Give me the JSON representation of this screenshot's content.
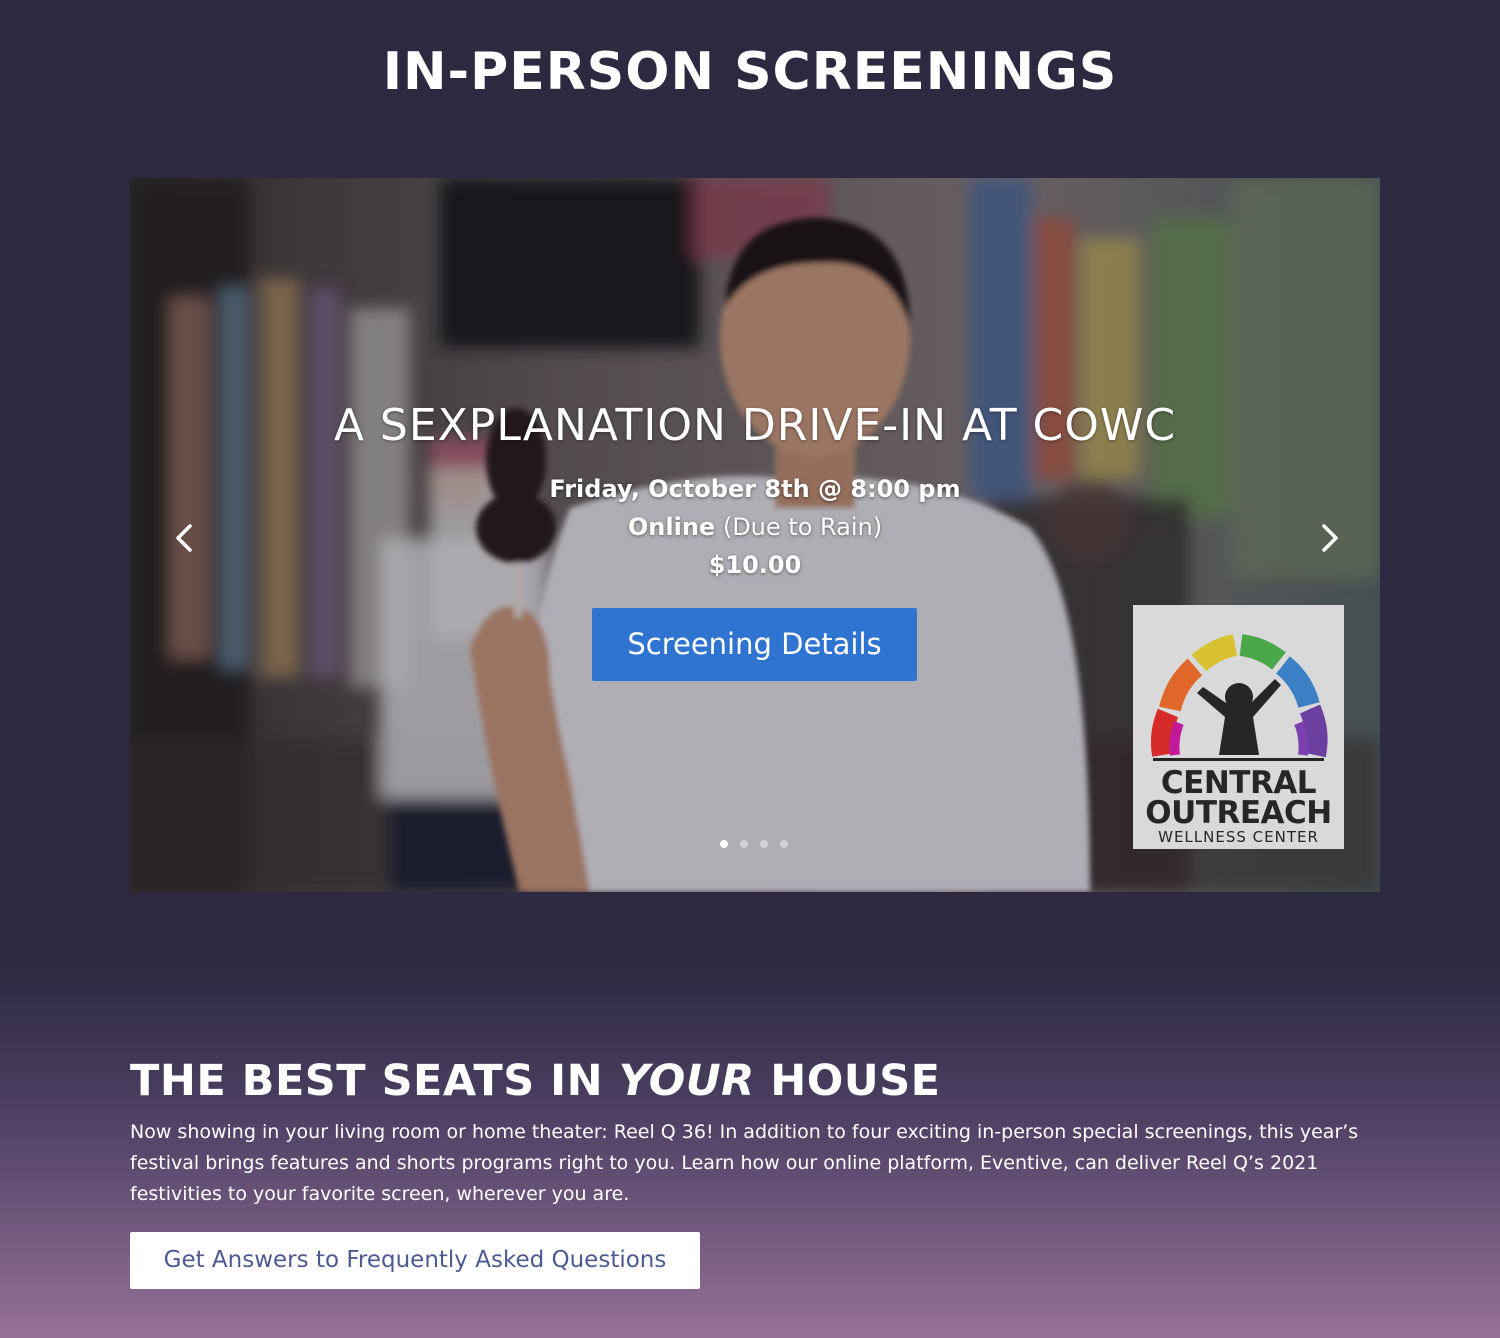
{
  "screenings": {
    "heading": "IN-PERSON SCREENINGS",
    "slide": {
      "title": "A SEXPLANATION DRIVE-IN AT COWC",
      "date": "Friday, October 8th @ 8:00 pm",
      "venue_bold": "Online",
      "venue_note": "(Due to Rain)",
      "price": "$10.00",
      "button_label": "Screening Details"
    },
    "carousel": {
      "prev_icon": "chevron-left-icon",
      "next_icon": "chevron-right-icon",
      "slide_count": 4,
      "active_slide": 1
    },
    "sponsor": {
      "logo_line_1": "CENTRAL",
      "logo_line_2": "OUTREACH",
      "logo_line_3": "WELLNESS CENTER"
    }
  },
  "seats": {
    "heading_start": "THE BEST SEATS IN ",
    "heading_emphasis": "YOUR",
    "heading_end": " HOUSE",
    "body": "Now showing in your living room or home theater: Reel Q 36! In addition to four exciting in-person special screenings, this year’s festival brings features and shorts programs right to you. Learn how our online platform, Eventive, can deliver Reel Q’s 2021 festivities to your favorite screen, wherever you are.",
    "button_label": "Get Answers to Frequently Asked Questions"
  },
  "colors": {
    "page_background": "#2c2940",
    "gradient_bottom": "#977199",
    "button_primary": "#2f74d0",
    "faq_button_text": "#4c5a94"
  }
}
